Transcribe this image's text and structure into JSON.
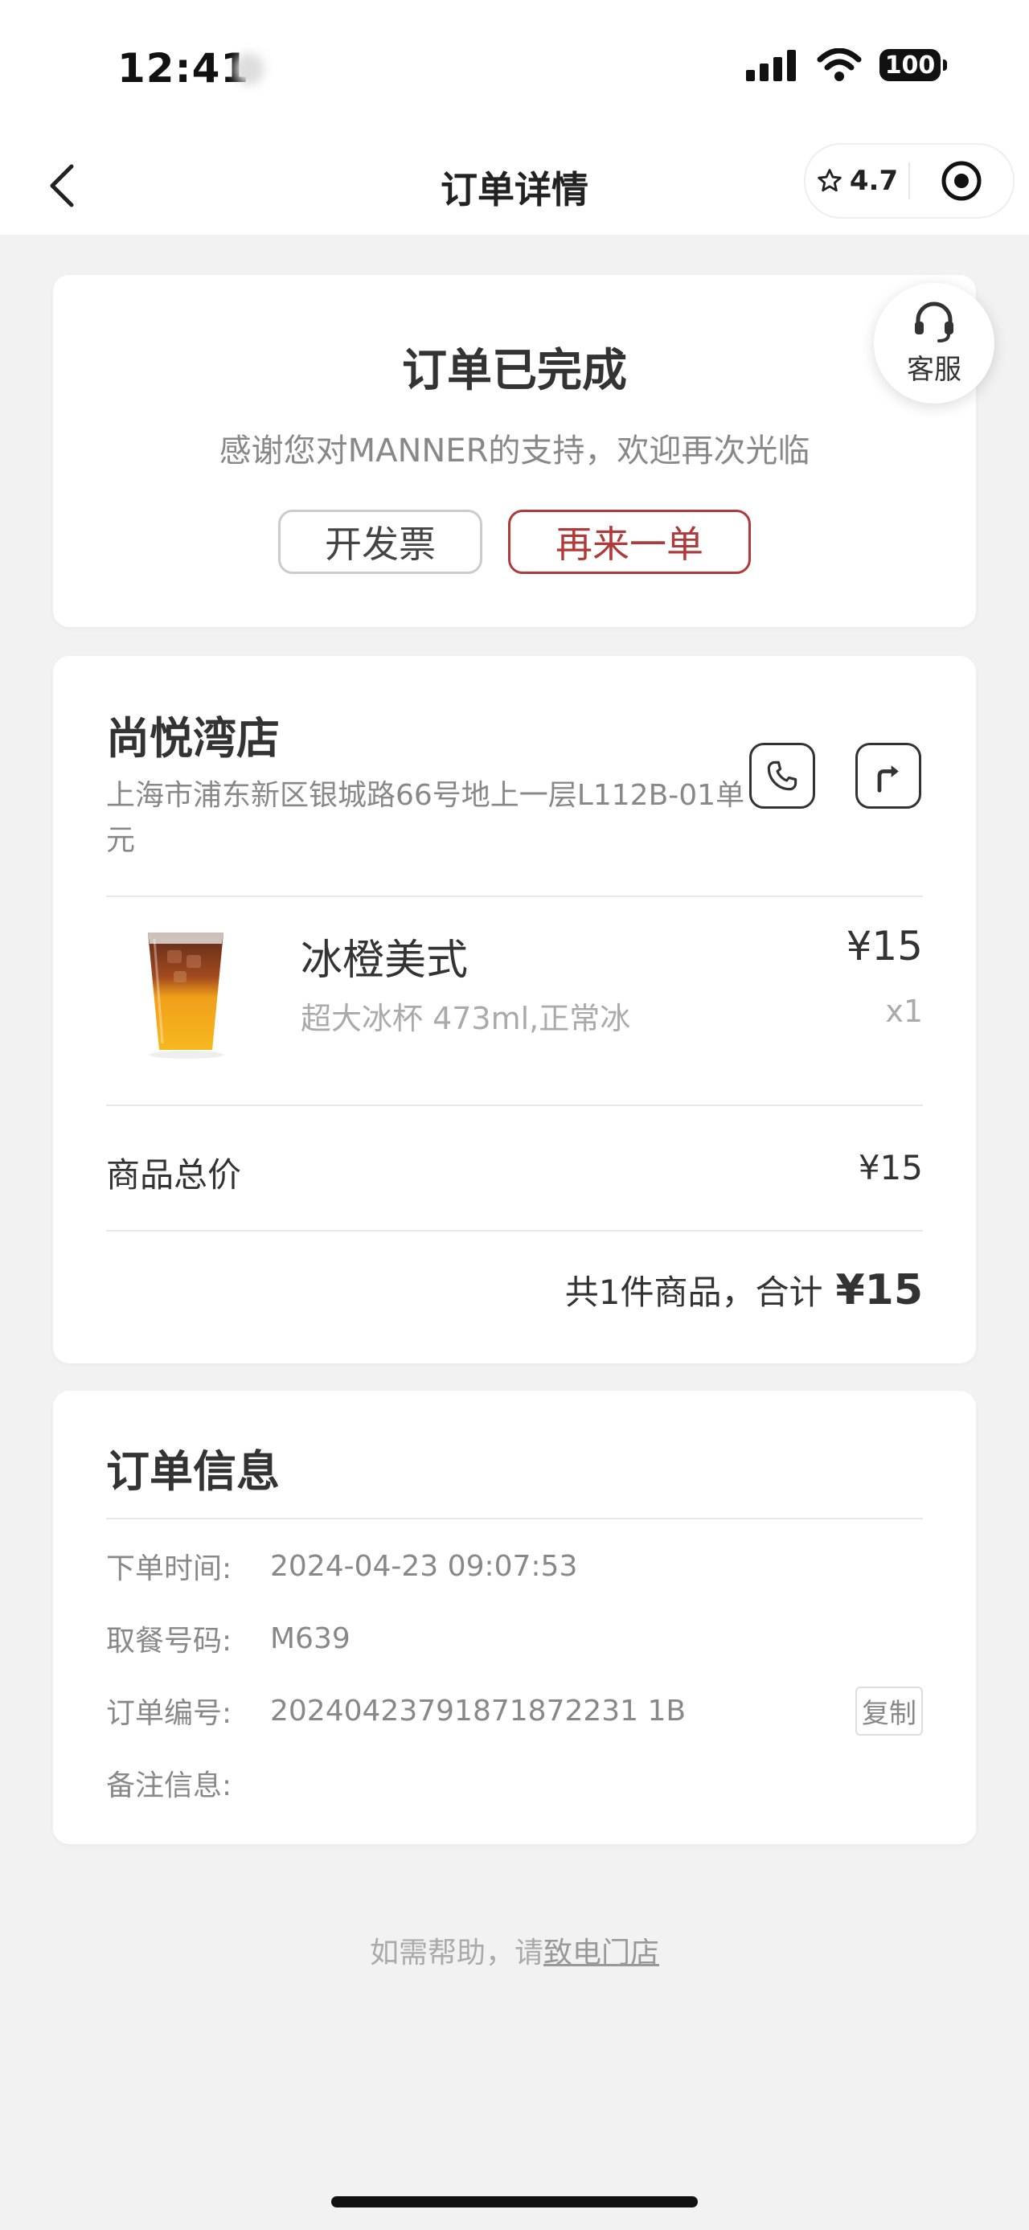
{
  "status_bar": {
    "time": "12:41",
    "battery": "100"
  },
  "nav": {
    "title": "订单详情",
    "rating": "4.7"
  },
  "order_status": {
    "title": "订单已完成",
    "subtitle": "感谢您对MANNER的支持，欢迎再次光临",
    "invoice_button": "开发票",
    "reorder_button": "再来一单"
  },
  "customer_service": {
    "label": "客服"
  },
  "store": {
    "name": "尚悦湾店",
    "address": "上海市浦东新区银城路66号地上一层L112B-01单元"
  },
  "product": {
    "name": "冰橙美式",
    "spec": "超大冰杯 473ml,正常冰",
    "price": "¥15",
    "qty": "x1"
  },
  "summary": {
    "subtotal_label": "商品总价",
    "subtotal_value": "¥15",
    "total_text": "共1件商品，合计",
    "total_value": "¥15"
  },
  "order_info": {
    "title": "订单信息",
    "rows": [
      {
        "label": "下单时间:",
        "value": "2024-04-23 09:07:53"
      },
      {
        "label": "取餐号码:",
        "value": "M639"
      },
      {
        "label": "订单编号:",
        "value": "20240423791871872231 1B"
      },
      {
        "label": "备注信息:",
        "value": ""
      }
    ],
    "copy_button": "复制"
  },
  "help": {
    "prefix": "如需帮助，请",
    "link": "致电门店"
  },
  "colors": {
    "accent": "#b03a3a",
    "background": "#f2f2f2"
  }
}
